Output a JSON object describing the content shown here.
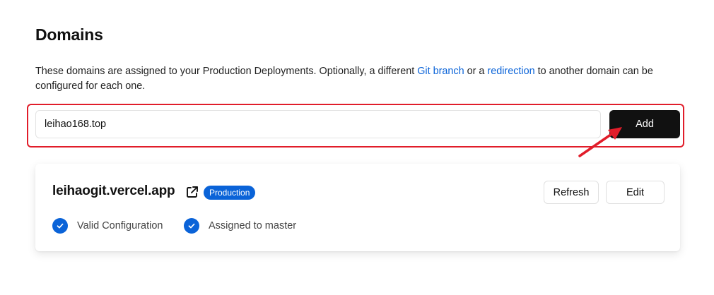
{
  "section": {
    "title": "Domains",
    "description": {
      "part1": "These domains are assigned to your Production Deployments. Optionally, a different ",
      "link_git_branch": "Git branch",
      "part2": " or a ",
      "link_redirection": "redirection",
      "part3": " to another domain can be configured for each one."
    }
  },
  "add_domain": {
    "input_value": "leihao168.top",
    "add_label": "Add"
  },
  "domain_card": {
    "domain": "leihaogit.vercel.app",
    "badge": "Production",
    "refresh_label": "Refresh",
    "edit_label": "Edit",
    "status_items": [
      {
        "label": "Valid Configuration",
        "icon": "check-circle-icon"
      },
      {
        "label": "Assigned to master",
        "icon": "check-circle-icon"
      }
    ]
  },
  "colors": {
    "accent": "#0a63d8",
    "primary_button": "#111111",
    "highlight_border": "#e11d2a"
  }
}
